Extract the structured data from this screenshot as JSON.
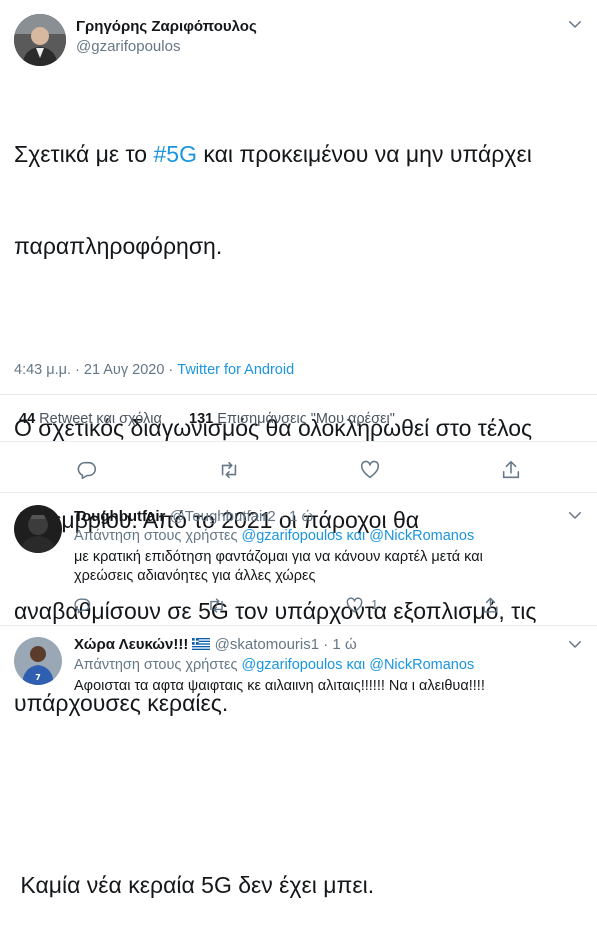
{
  "tweet": {
    "author_name": "Γρηγόρης Ζαριφόπουλος",
    "author_handle": "@gzarifopoulos",
    "line1_pre": "Σχετικά με το ",
    "line1_hashtag": "#5G",
    "line1_post": " και προκειμένου να μην υπάρχει",
    "line2": "παραπληροφόρηση.",
    "para2_l1": "Ο σχετικός διαγωνισμός θα ολοκληρωθεί στο τέλος",
    "para2_l2": "Δεκεμβρίου. Από το 2021 οι πάροχοι θα",
    "para2_l3": "αναβαθμίσουν σε 5G τον υπάρχοντα εξοπλισμό, τις",
    "para2_l4": "υπάρχουσες κεραίες.",
    "para3": " Καμία νέα κεραία 5G δεν έχει μπει.",
    "time": "4:43 μ.μ. · 21 Αυγ 2020 · ",
    "source": "Twitter for Android",
    "retweets_count": "44",
    "retweets_label": "Retweet και σχόλια",
    "likes_count": "131",
    "likes_label": "Επισημάνσεις \"Μου αρέσει\""
  },
  "replies": [
    {
      "name": "Toughbutfair",
      "handle": "@Toughbutfair2",
      "age": "· 1 ώ",
      "reply_prefix": "Απάντηση στους χρήστες ",
      "reply_to": "@gzarifopoulos και @NickRomanos",
      "line1": "με κρατική επιδότηση φαντάζομαι για να κάνουν καρτέλ μετά και",
      "line2": "χρεώσεις αδιανόητες για άλλες χώρες",
      "like_count": "1"
    },
    {
      "name": "Χώρα Λευκών!!!",
      "handle": "@skatomouris1",
      "age": "· 1 ώ",
      "reply_prefix": "Απάντηση στους χρήστες ",
      "reply_to": "@gzarifopoulos και @NickRomanos",
      "line1": "Αφοισται τα αφτα ψαιφταις κε αιλαιινη αλιταις!!!!!! Να ι αλειθυα!!!!"
    }
  ],
  "icons": [
    "reply-icon",
    "retweet-icon",
    "like-icon",
    "share-icon",
    "chevron-down-icon",
    "greek-flag-icon"
  ],
  "colors": {
    "link": "#1b95e0",
    "muted": "#657786",
    "text": "#14171a",
    "divider": "#e6ecf0"
  }
}
